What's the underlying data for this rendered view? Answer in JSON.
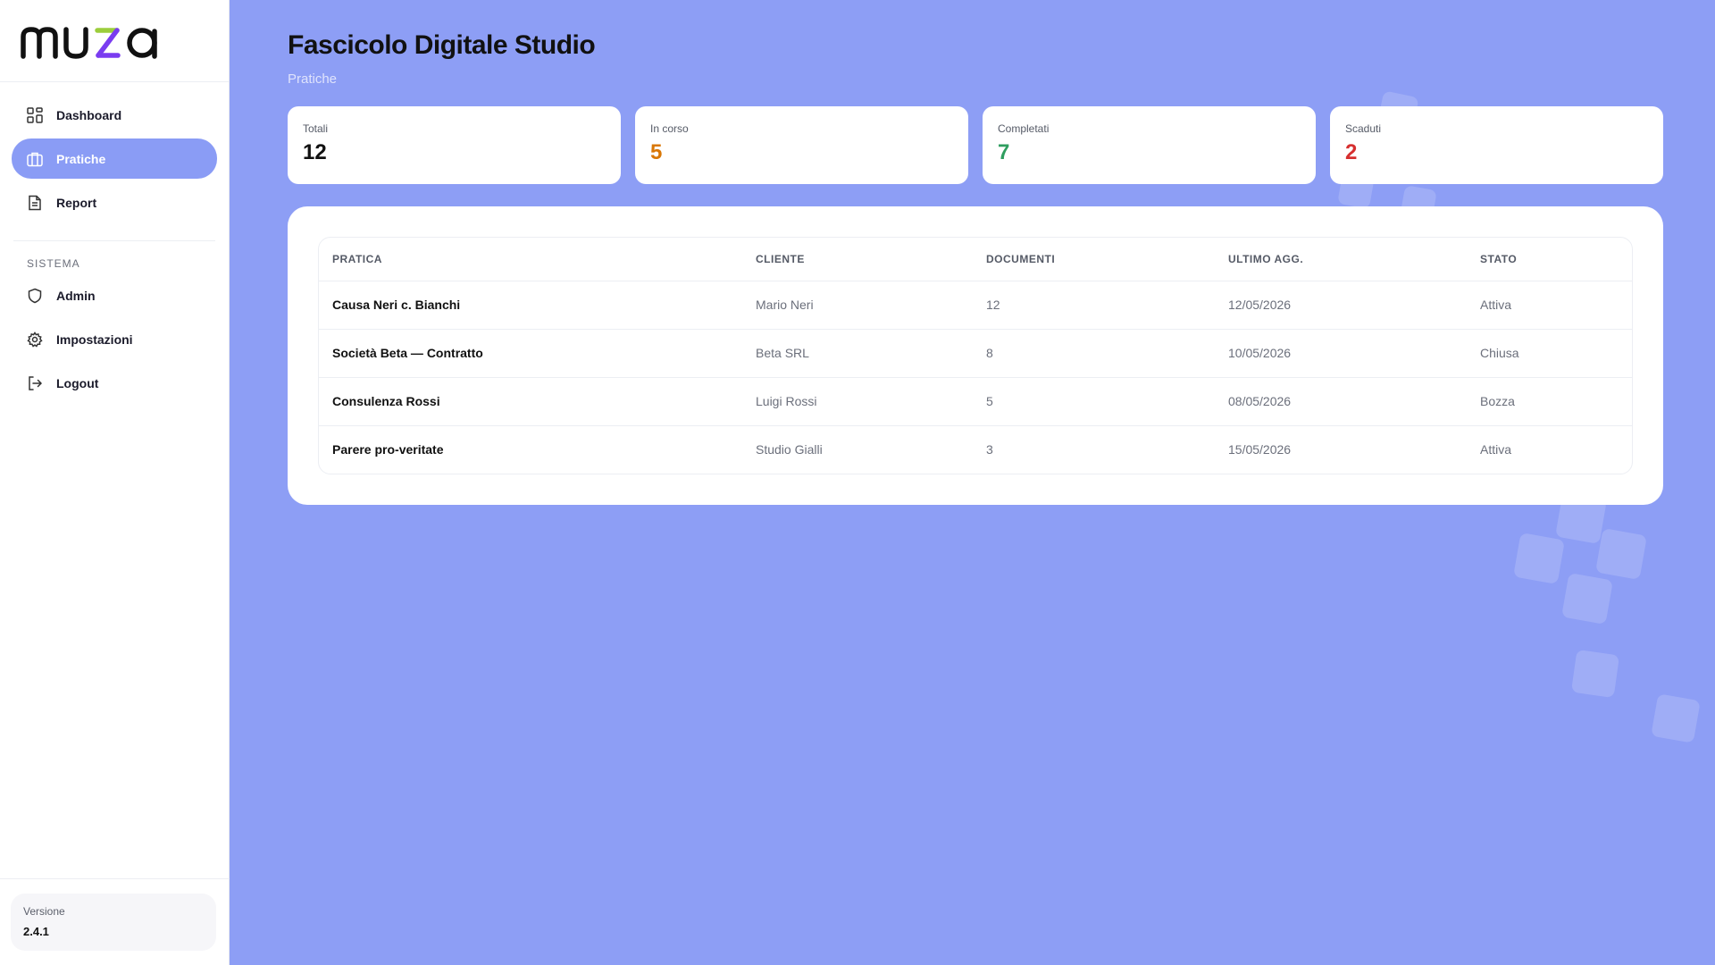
{
  "brand": {
    "name": "muza",
    "accent_purple": "#7a3cf0",
    "accent_green": "#9ccd3c"
  },
  "sidebar": {
    "nav": [
      {
        "label": "Dashboard",
        "icon": "grid-icon",
        "active": false
      },
      {
        "label": "Pratiche",
        "icon": "briefcase-icon",
        "active": true
      },
      {
        "label": "Report",
        "icon": "document-icon",
        "active": false
      }
    ],
    "section_title": "SISTEMA",
    "system": [
      {
        "label": "Admin",
        "icon": "shield-icon"
      },
      {
        "label": "Impostazioni",
        "icon": "gear-icon"
      },
      {
        "label": "Logout",
        "icon": "logout-icon"
      }
    ],
    "version": {
      "label": "Versione",
      "value": "2.4.1"
    }
  },
  "header": {
    "title": "Fascicolo Digitale Studio",
    "subtitle": "Pratiche"
  },
  "stats": [
    {
      "label": "Totali",
      "value": "12",
      "color": "#111111"
    },
    {
      "label": "In corso",
      "value": "5",
      "color": "#d97706"
    },
    {
      "label": "Completati",
      "value": "7",
      "color": "#2f9e5f"
    },
    {
      "label": "Scaduti",
      "value": "2",
      "color": "#d62f2f"
    }
  ],
  "table": {
    "columns": [
      "PRATICA",
      "CLIENTE",
      "DOCUMENTI",
      "ULTIMO AGG.",
      "STATO"
    ],
    "rows": [
      [
        "Causa Neri c. Bianchi",
        "Mario Neri",
        "12",
        "12/05/2026",
        "Attiva"
      ],
      [
        "Società Beta — Contratto",
        "Beta SRL",
        "8",
        "10/05/2026",
        "Chiusa"
      ],
      [
        "Consulenza Rossi",
        "Luigi Rossi",
        "5",
        "08/05/2026",
        "Bozza"
      ],
      [
        "Parere pro-veritate",
        "Studio Gialli",
        "3",
        "15/05/2026",
        "Attiva"
      ]
    ]
  }
}
